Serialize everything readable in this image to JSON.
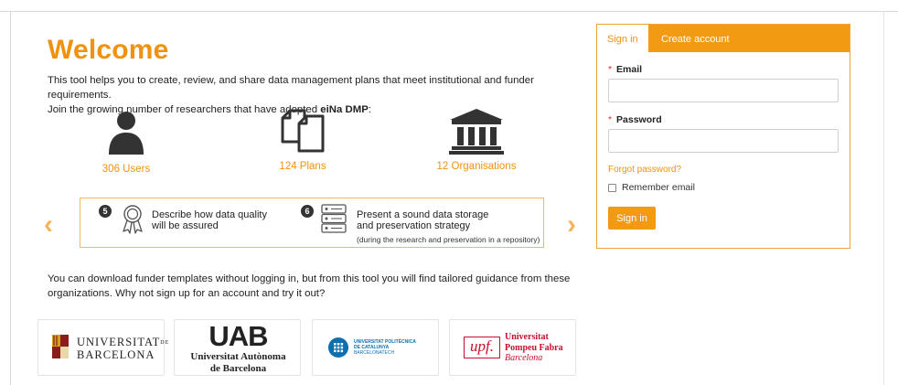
{
  "welcome": {
    "title": "Welcome",
    "intro_line1": "This tool helps you to create, review, and share data management plans that meet institutional and funder requirements.",
    "intro_line2_prefix": "Join the growing number of researchers that have adopted ",
    "intro_brand": "eiNa DMP",
    "intro_line2_suffix": ":"
  },
  "stats": {
    "users": "306 Users",
    "plans": "124 Plans",
    "organisations": "12 Organisations"
  },
  "carousel": {
    "step5_num": "5",
    "step5_text_a": "Describe how data quality",
    "step5_text_b": "will be assured",
    "step6_num": "6",
    "step6_text_a": "Present a sound data storage",
    "step6_text_b": "and preservation strategy",
    "step6_sub": "(during the research and preservation in a repository)",
    "prev_glyph": "‹",
    "next_glyph": "›"
  },
  "download_text": "You can download funder templates without logging in, but from this tool you will find tailored guidance from these organizations. Why not sign up for an account and try it out?",
  "logos": {
    "ub_line1": "UNIVERSITAT",
    "ub_sup": "DE",
    "ub_line2": "BARCELONA",
    "uab_mark": "UAB",
    "uab_line1": "Universitat Autònoma",
    "uab_line2": "de Barcelona",
    "upc_line1": "UNIVERSITAT POLITÈCNICA",
    "upc_line2": "DE CATALUNYA",
    "upc_line3": "BARCELONATECH",
    "upf_mark": "upf.",
    "upf_line1": "Universitat",
    "upf_line2": "Pompeu Fabra",
    "upf_line3": "Barcelona"
  },
  "auth": {
    "tab_signin": "Sign in",
    "tab_create": "Create account",
    "email_label": "Email",
    "password_label": "Password",
    "required_mark": "*",
    "email_value": "",
    "password_value": "",
    "forgot_link": "Forgot password?",
    "remember_label": "Remember email",
    "submit_label": "Sign in"
  },
  "colors": {
    "accent": "#f29a12",
    "accent_text": "#f0920e",
    "panel_border": "#f0a23a",
    "required": "#e23"
  }
}
